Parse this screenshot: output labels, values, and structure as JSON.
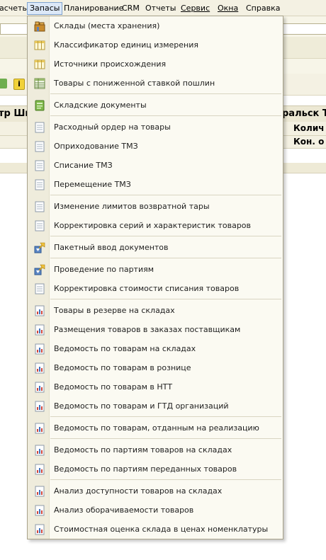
{
  "menubar": {
    "items": [
      "асчеты",
      "Запасы",
      "Планирование",
      "CRM",
      "Отчеты",
      "Сервис",
      "Окна",
      "Справка"
    ],
    "active_index": 1
  },
  "background": {
    "header_left": "тр Шы",
    "header_right": "ральск Т",
    "row1_right": "Колич",
    "row2_right": "Кон. о"
  },
  "dropdown": {
    "items": [
      {
        "label": "Склады (места хранения)",
        "icon": "warehouse-icon"
      },
      {
        "label": "Классификатор единиц измерения",
        "icon": "catalog-icon"
      },
      {
        "label": "Источники происхождения",
        "icon": "catalog-icon"
      },
      {
        "label": "Товары с пониженной ставкой пошлин",
        "icon": "register-icon"
      },
      {
        "label": "Складские документы",
        "icon": "journal-icon"
      },
      {
        "label": "Расходный ордер на товары",
        "icon": "document-icon"
      },
      {
        "label": "Оприходование ТМЗ",
        "icon": "document-icon"
      },
      {
        "label": "Списание ТМЗ",
        "icon": "document-icon"
      },
      {
        "label": "Перемещение ТМЗ",
        "icon": "document-icon"
      },
      {
        "label": "Изменение лимитов возвратной тары",
        "icon": "document-icon"
      },
      {
        "label": "Корректировка серий и характеристик товаров",
        "icon": "document-icon"
      },
      {
        "label": "Пакетный ввод документов",
        "icon": "processing-icon"
      },
      {
        "label": "Проведение по партиям",
        "icon": "processing-icon"
      },
      {
        "label": "Корректировка стоимости списания товаров",
        "icon": "document-icon"
      },
      {
        "label": "Товары в резерве на складах",
        "icon": "report-icon"
      },
      {
        "label": "Размещения товаров в заказах поставщикам",
        "icon": "report-icon"
      },
      {
        "label": "Ведомость по товарам на складах",
        "icon": "report-icon"
      },
      {
        "label": "Ведомость по товарам в рознице",
        "icon": "report-icon"
      },
      {
        "label": "Ведомость по товарам в НТТ",
        "icon": "report-icon"
      },
      {
        "label": "Ведомость по товарам и ГТД организаций",
        "icon": "report-icon"
      },
      {
        "label": "Ведомость по товарам, отданным на реализацию",
        "icon": "report-icon"
      },
      {
        "label": "Ведомость по партиям товаров на складах",
        "icon": "report-icon"
      },
      {
        "label": "Ведомость по партиям переданных товаров",
        "icon": "report-icon"
      },
      {
        "label": "Анализ доступности товаров на складах",
        "icon": "report-icon"
      },
      {
        "label": "Анализ оборачиваемости товаров",
        "icon": "report-icon"
      },
      {
        "label": "Стоимостная оценка склада в ценах номенклатуры",
        "icon": "report-icon"
      }
    ]
  }
}
